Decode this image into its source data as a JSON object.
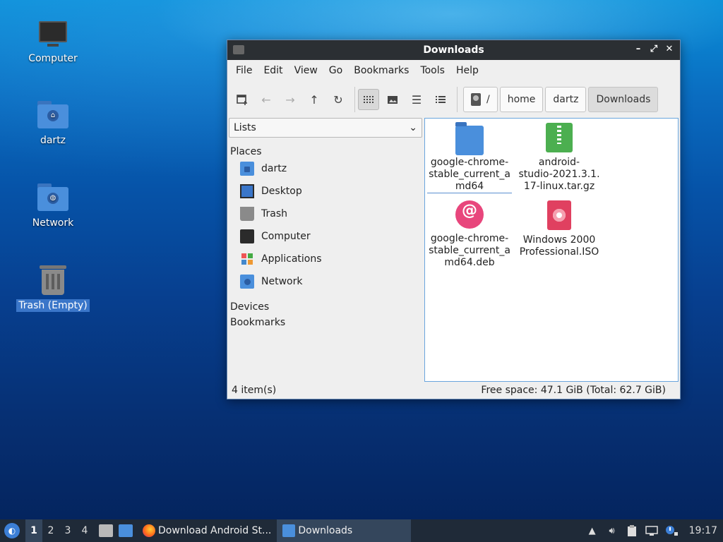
{
  "desktop": {
    "icons": [
      {
        "label": "Computer",
        "icon": "computer-icon"
      },
      {
        "label": "dartz",
        "icon": "home-folder-icon"
      },
      {
        "label": "Network",
        "icon": "network-folder-icon"
      },
      {
        "label": "Trash (Empty)",
        "icon": "trash-icon",
        "selected": true
      }
    ]
  },
  "window": {
    "title": "Downloads",
    "controls": {
      "minimize": "–",
      "maximize": "⤢",
      "close": "✕"
    },
    "menu": [
      "File",
      "Edit",
      "View",
      "Go",
      "Bookmarks",
      "Tools",
      "Help"
    ],
    "toolbar": {
      "view_mode_active": "icon-view",
      "path": {
        "root": "/",
        "segments": [
          "home",
          "dartz",
          "Downloads"
        ],
        "current": "Downloads"
      }
    },
    "sidepane": {
      "mode": "Lists",
      "places_header": "Places",
      "places": [
        {
          "label": "dartz",
          "icon": "home-folder-icon"
        },
        {
          "label": "Desktop",
          "icon": "desktop-icon"
        },
        {
          "label": "Trash",
          "icon": "trash-icon"
        },
        {
          "label": "Computer",
          "icon": "computer-icon"
        },
        {
          "label": "Applications",
          "icon": "applications-icon"
        },
        {
          "label": "Network",
          "icon": "network-icon"
        }
      ],
      "devices_header": "Devices",
      "bookmarks_header": "Bookmarks"
    },
    "files": [
      {
        "name": "google-chrome-stable_current_amd64",
        "type": "folder"
      },
      {
        "name": "android-studio-2021.3.1.17-linux.tar.gz",
        "type": "archive"
      },
      {
        "name": "google-chrome-stable_current_amd64.deb",
        "type": "deb-package"
      },
      {
        "name": "Windows 2000 Professional.ISO",
        "type": "disc-image"
      }
    ],
    "file_names_wrapped": [
      "google-chrome-\nstable_current_a\nmd64",
      "android-\nstudio-2021.3.1.\n17-linux.tar.gz",
      "google-chrome-\nstable_current_a\nmd64.deb",
      "Windows 2000\nProfessional.ISO"
    ],
    "status": {
      "items": "4 item(s)",
      "space": "Free space: 47.1 GiB (Total: 62.7 GiB)"
    }
  },
  "taskbar": {
    "workspaces": [
      "1",
      "2",
      "3",
      "4"
    ],
    "active_workspace": "1",
    "tasks": [
      {
        "label": "Download Android St...",
        "icon": "firefox-icon"
      },
      {
        "label": "Downloads",
        "icon": "folder-icon",
        "active": true
      }
    ],
    "clock": "19:17"
  },
  "colors": {
    "accent": "#3a76c9",
    "titlebar": "#2b2f33",
    "taskbar": "#1f2a38",
    "folder": "#4a8fdc"
  }
}
